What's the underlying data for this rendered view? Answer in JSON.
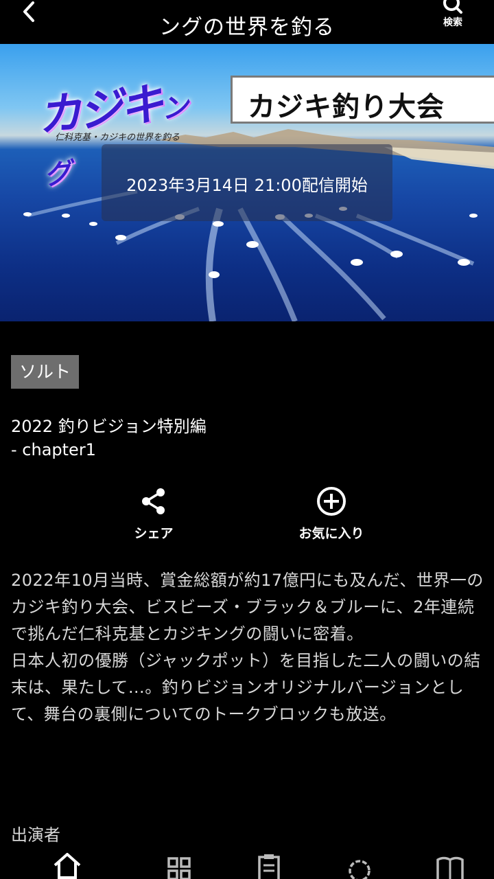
{
  "header": {
    "title": "ングの世界を釣る",
    "search_label": "検索",
    "icons": {
      "back": "chevron-left-icon",
      "search": "search-icon"
    }
  },
  "hero": {
    "banner_title": "カジキ釣り大会",
    "logo_text": "カジキング",
    "logo_subtitle": "仁科克基・カジキの世界を釣る",
    "broadcast_date": "2023年3月14日 21:00配信開始"
  },
  "genre_tag": "ソルト",
  "episode": {
    "title_line1": "2022 釣りビジョン特別編",
    "title_line2": "- chapter1"
  },
  "actions": {
    "share_label": "シェア",
    "favorite_label": "お気に入り"
  },
  "description": {
    "paragraph1": "2022年10月当時、賞金総額が約17億円にも及んだ、世界一のカジキ釣り大会、ビスビーズ・ブラック＆ブルーに、2年連続で挑んだ仁科克基とカジキングの闘いに密着。",
    "paragraph2": "日本人初の優勝（ジャックポット）を目指した二人の闘いの結末は、果たして…。釣りビジョンオリジナルバージョンとして、舞台の裏側についてのトークブロックも放送。"
  },
  "cast_label": "出演者",
  "tabbar": {
    "icons": [
      "home-icon",
      "grid-icon",
      "clipboard-icon",
      "settings-icon",
      "book-icon"
    ],
    "active": "home-icon"
  },
  "colors": {
    "background": "#000000",
    "tag_bg": "#6e6e6e",
    "text": "#ffffff",
    "body_text": "#d8d8d8"
  }
}
